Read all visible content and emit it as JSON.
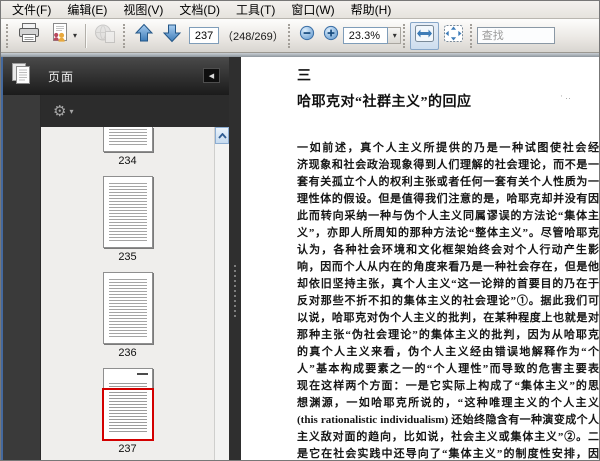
{
  "menu": {
    "items": [
      "文件(F)",
      "编辑(E)",
      "视图(V)",
      "文档(D)",
      "工具(T)",
      "窗口(W)",
      "帮助(H)"
    ]
  },
  "toolbar": {
    "page_input": "237",
    "page_count": "（248/269）",
    "zoom_value": "23.3%",
    "find_placeholder": "查找",
    "icons": [
      "print-icon",
      "collaborate-icon",
      "share-globe-icon",
      "previous-page-icon",
      "next-page-icon",
      "zoom-out-icon",
      "zoom-in-icon",
      "fit-width-icon",
      "fit-page-icon"
    ]
  },
  "sidebar": {
    "panel_title": "页面",
    "icons": [
      "pages-icon",
      "gear-icon",
      "collapse-panel-icon",
      "scroll-up-icon"
    ],
    "thumbnails": [
      {
        "label": "234",
        "partial": true
      },
      {
        "label": "235"
      },
      {
        "label": "236"
      },
      {
        "label": "237",
        "selected": true
      }
    ]
  },
  "document": {
    "section_number": "三",
    "title": "哈耶克对“社群主义”的回应",
    "lines": [
      "一如前述，真个人主义所提供的乃是一种试图使社会经",
      "济现象和社会政治现象得到人们理解的社会理论，而不是一",
      "套有关孤立个人的权利主张或者任何一套有关个人性质为一",
      "理性体的假设。但是值得我们注意的是，哈耶克却并没有因",
      "此而转向采纳一种与伪个人主义同属谬误的方法论“集体主",
      "义”，亦即人所周知的那种方法论“整体主义”。尽管哈耶克",
      "认为，各种社会环境和文化框架始终会对个人行动产生影",
      "响，因而个人从内在的角度来看乃是一种社会存在，但是他",
      "却依旧坚持主张，真个人主义“这一论辩的首要目的乃在于",
      "反对那些不折不扣的集体主义的社会理论”①。据此我们可",
      "以说，哈耶克对伪个人主义的批判，在某种程度上也就是对",
      "那种主张“伪社会理论”的集体主义的批判，因为从哈耶克",
      "的真个人主义来看，伪个人主义经由错误地解释作为“个",
      "人”基本构成要素之一的“个人理性”而导致的危害主要表",
      "现在这样两个方面：一是它实际上构成了“集体主义”的思",
      "想渊源，一如哈耶克所说的，“这种唯理主义的个人主义",
      "(this rationalistic individualism) 还始终隐含有一种演变成个人",
      "主义敌对面的趋向，比如说，社会主义或集体主义”②。二",
      "是它在社会实践中还导向了“集体主义”的制度性安排，因"
    ]
  },
  "colors": {
    "selection_red": "#d30000",
    "accent_blue": "#4a84c4",
    "panel_dark": "#373737"
  }
}
